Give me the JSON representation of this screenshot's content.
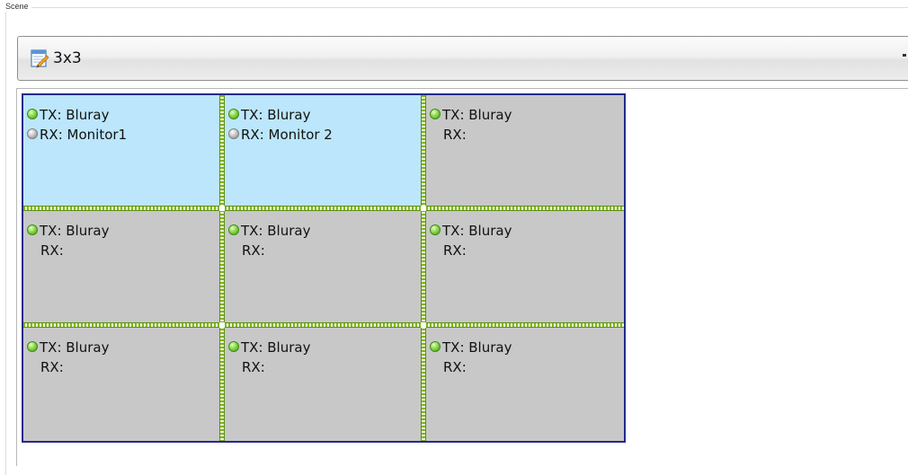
{
  "group": {
    "title": "Scene"
  },
  "scene_select": {
    "value": "3x3",
    "icon": "note-edit-icon",
    "dropdown_icon": "dropdown-arrow-icon"
  },
  "colors": {
    "selected_cell": "#bce6fb",
    "unselected_cell": "#c8c8c8",
    "wall_border": "#232a8a",
    "divider_green": "#7fb51d",
    "status_green": "#5cc01e",
    "status_gray": "#a0a0a0"
  },
  "video_wall": {
    "rows": 3,
    "columns": 3,
    "cells": [
      {
        "tx": "TX: Bluray",
        "rx": "RX: Monitor1",
        "selected": true,
        "tx_status": "green",
        "rx_status": "gray"
      },
      {
        "tx": "TX: Bluray",
        "rx": "RX: Monitor 2",
        "selected": true,
        "tx_status": "green",
        "rx_status": "gray"
      },
      {
        "tx": "TX: Bluray",
        "rx": "RX:",
        "selected": false,
        "tx_status": "green",
        "rx_status": "none"
      },
      {
        "tx": "TX: Bluray",
        "rx": "RX:",
        "selected": false,
        "tx_status": "green",
        "rx_status": "none"
      },
      {
        "tx": "TX: Bluray",
        "rx": "RX:",
        "selected": false,
        "tx_status": "green",
        "rx_status": "none"
      },
      {
        "tx": "TX: Bluray",
        "rx": "RX:",
        "selected": false,
        "tx_status": "green",
        "rx_status": "none"
      },
      {
        "tx": "TX: Bluray",
        "rx": "RX:",
        "selected": false,
        "tx_status": "green",
        "rx_status": "none"
      },
      {
        "tx": "TX: Bluray",
        "rx": "RX:",
        "selected": false,
        "tx_status": "green",
        "rx_status": "none"
      },
      {
        "tx": "TX: Bluray",
        "rx": "RX:",
        "selected": false,
        "tx_status": "green",
        "rx_status": "none"
      }
    ]
  }
}
